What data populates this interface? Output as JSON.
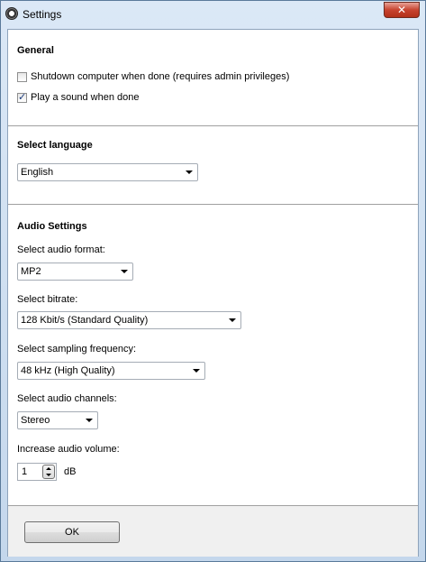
{
  "window": {
    "title": "Settings",
    "close_label": "✕"
  },
  "general": {
    "heading": "General",
    "shutdown_label": "Shutdown computer when done (requires admin privileges)",
    "shutdown_checked": false,
    "sound_label": "Play a sound when done",
    "sound_checked": true
  },
  "language": {
    "heading": "Select language",
    "value": "English"
  },
  "audio": {
    "heading": "Audio Settings",
    "format_label": "Select audio format:",
    "format_value": "MP2",
    "bitrate_label": "Select bitrate:",
    "bitrate_value": "128 Kbit/s (Standard Quality)",
    "sampling_label": "Select sampling frequency:",
    "sampling_value": "48 kHz (High Quality)",
    "channels_label": "Select audio channels:",
    "channels_value": "Stereo",
    "volume_label": "Increase audio volume:",
    "volume_value": "1",
    "volume_unit": "dB"
  },
  "footer": {
    "ok_label": "OK"
  }
}
